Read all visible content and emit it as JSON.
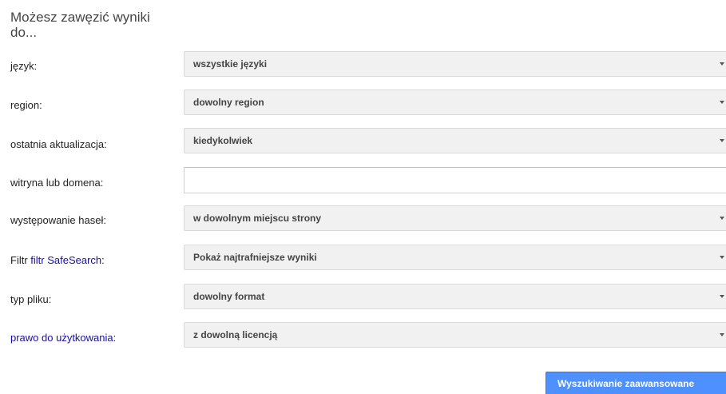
{
  "heading": "Możesz zawęzić wyniki do...",
  "fields": {
    "language": {
      "label": "język:",
      "value": "wszystkie języki"
    },
    "region": {
      "label": "region:",
      "value": "dowolny region"
    },
    "last_update": {
      "label": "ostatnia aktualizacja:",
      "value": "kiedykolwiek"
    },
    "site": {
      "label": "witryna lub domena:",
      "value": ""
    },
    "terms_appearing": {
      "label": "występowanie haseł:",
      "value": "w dowolnym miejscu strony"
    },
    "safesearch": {
      "label_prefix": "Filtr ",
      "label_link": "filtr SafeSearch",
      "label_suffix": ":",
      "value": "Pokaż najtrafniejsze wyniki"
    },
    "file_type": {
      "label": "typ pliku:",
      "value": "dowolny format"
    },
    "usage_rights": {
      "label_link": "prawo do użytkowania",
      "label_suffix": ":",
      "value": "z dowolną licencją"
    }
  },
  "submit_label": "Wyszukiwanie zaawansowane",
  "colors": {
    "link": "#1a0dab",
    "button": "#4d90fe",
    "select_bg": "#f1f1f1"
  },
  "icons": {
    "dropdown": "chevron-down-icon"
  }
}
